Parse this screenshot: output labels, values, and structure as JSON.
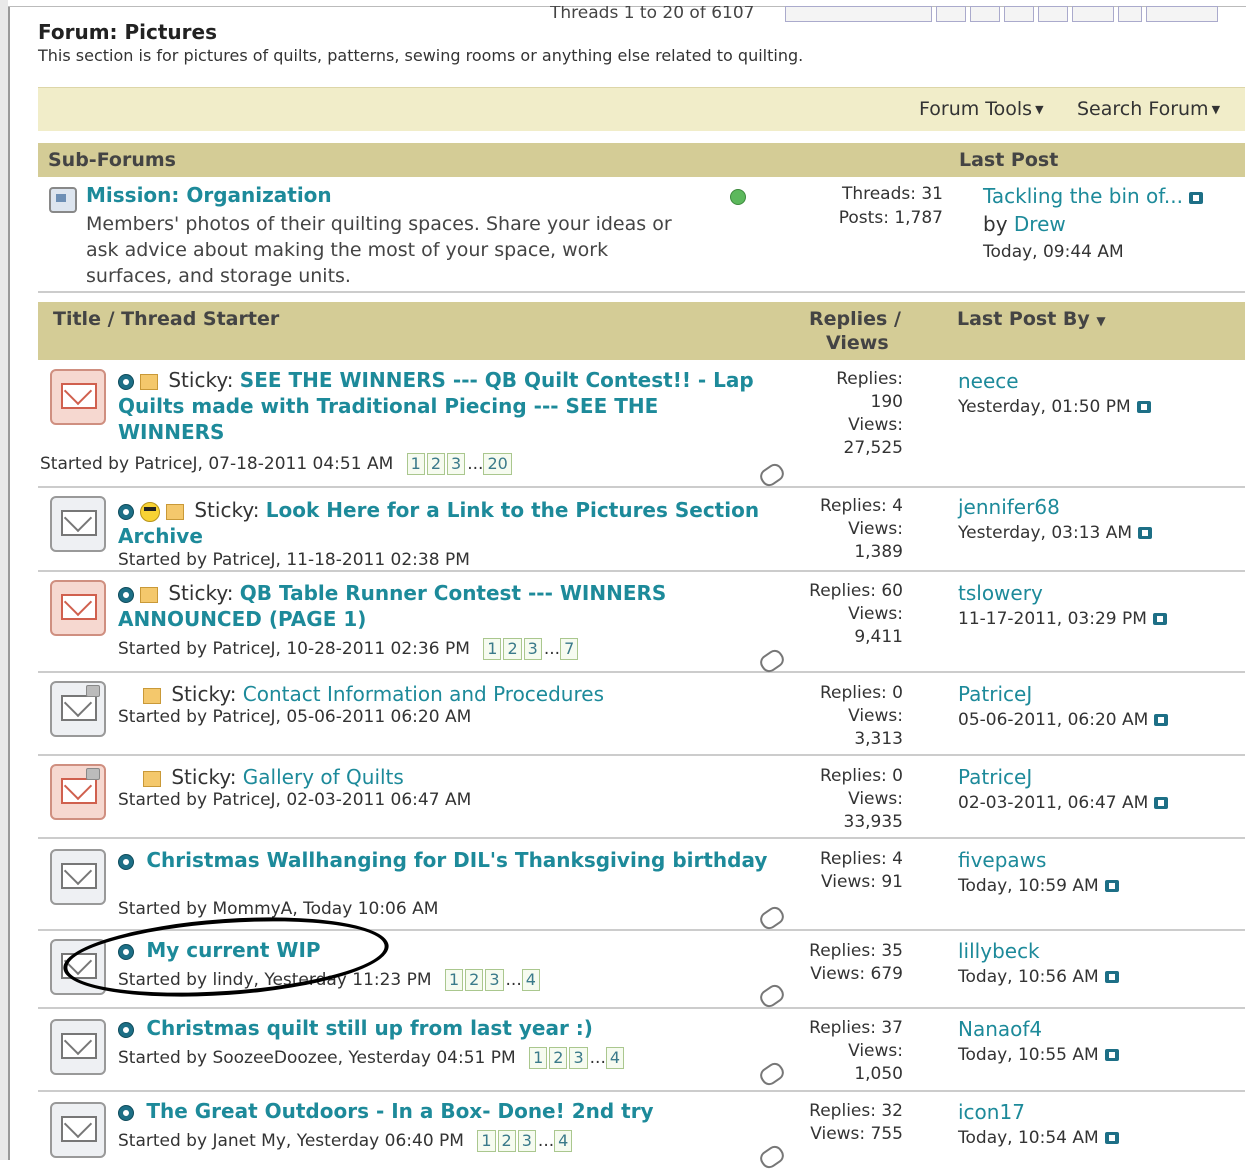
{
  "header": {
    "forum_title": "Forum: Pictures",
    "forum_desc": "This section is for pictures of quilts, patterns, sewing rooms or anything else related to quilting.",
    "threads_count": "Threads 1 to 20 of 6107"
  },
  "toolbar": {
    "forum_tools": "Forum Tools",
    "search_forum": "Search Forum"
  },
  "subforums_header": {
    "label": "Sub-Forums",
    "last_post": "Last Post"
  },
  "subforum": {
    "title": "Mission: Organization",
    "desc": "Members' photos of their quilting spaces. Share your ideas or ask advice about making the most of your space, work surfaces, and storage units.",
    "threads": "Threads: 31",
    "posts": "Posts: 1,787",
    "last_title": "Tackling the bin of...",
    "last_by_prefix": "by",
    "last_by": "Drew",
    "last_time": "Today, 09:44 AM"
  },
  "thread_header": {
    "title": "Title / Thread Starter",
    "replies": "Replies /",
    "views": "Views",
    "last_post_by": "Last Post By"
  },
  "threads": [
    {
      "prefix": "Sticky:",
      "title": "SEE THE WINNERS --- QB Quilt Contest!! - Lap Quilts made with Traditional Piecing --- SEE THE WINNERS",
      "starter": "Started by PatriceJ, 07-18-2011 04:51 AM",
      "pages": [
        "1",
        "2",
        "3",
        "...",
        "20"
      ],
      "replies_label": "Replies:",
      "replies": "190",
      "views_label": "Views:",
      "views": "27,525",
      "last_by": "neece",
      "last_time": "Yesterday, 01:50 PM"
    },
    {
      "prefix": "Sticky:",
      "title": "Look Here for a Link to the Pictures Section Archive",
      "starter": "Started by PatriceJ, 11-18-2011 02:38 PM",
      "replies": "Replies: 4",
      "views_label": "Views:",
      "views": "1,389",
      "last_by": "jennifer68",
      "last_time": "Yesterday, 03:13 AM"
    },
    {
      "prefix": "Sticky:",
      "title": "QB Table Runner Contest --- WINNERS ANNOUNCED (PAGE 1)",
      "starter": "Started by PatriceJ, 10-28-2011 02:36 PM",
      "pages": [
        "1",
        "2",
        "3",
        "...",
        "7"
      ],
      "replies": "Replies: 60",
      "views_label": "Views:",
      "views": "9,411",
      "last_by": "tslowery",
      "last_time": "11-17-2011, 03:29 PM"
    },
    {
      "prefix": "Sticky:",
      "title": "Contact Information and Procedures",
      "starter": "Started by PatriceJ, 05-06-2011 06:20 AM",
      "replies": "Replies: 0",
      "views_label": "Views:",
      "views": "3,313",
      "last_by": "PatriceJ",
      "last_time": "05-06-2011, 06:20 AM"
    },
    {
      "prefix": "Sticky:",
      "title": "Gallery of Quilts",
      "starter": "Started by PatriceJ, 02-03-2011 06:47 AM",
      "replies": "Replies: 0",
      "views_label": "Views:",
      "views": "33,935",
      "last_by": "PatriceJ",
      "last_time": "02-03-2011, 06:47 AM"
    },
    {
      "title": "Christmas Wallhanging for DIL's Thanksgiving birthday",
      "starter": "Started by MommyA, Today 10:06 AM",
      "replies": "Replies: 4",
      "views": "Views: 91",
      "last_by": "fivepaws",
      "last_time": "Today, 10:59 AM"
    },
    {
      "title": "My current WIP",
      "starter": "Started by lindy, Yesterday 11:23 PM",
      "pages": [
        "1",
        "2",
        "3",
        "...",
        "4"
      ],
      "replies": "Replies: 35",
      "views": "Views: 679",
      "last_by": "lillybeck",
      "last_time": "Today, 10:56 AM"
    },
    {
      "title": "Christmas quilt still up from last year :)",
      "starter": "Started by SoozeeDoozee, Yesterday 04:51 PM",
      "pages": [
        "1",
        "2",
        "3",
        "...",
        "4"
      ],
      "replies": "Replies: 37",
      "views_label": "Views:",
      "views": "1,050",
      "last_by": "Nanaof4",
      "last_time": "Today, 10:55 AM"
    },
    {
      "title": "The Great Outdoors - In a Box- Done! 2nd try",
      "starter": "Started by Janet My, Yesterday 06:40 PM",
      "pages": [
        "1",
        "2",
        "3",
        "...",
        "4"
      ],
      "replies": "Replies: 32",
      "views": "Views: 755",
      "last_by": "icon17",
      "last_time": "Today, 10:54 AM"
    }
  ]
}
